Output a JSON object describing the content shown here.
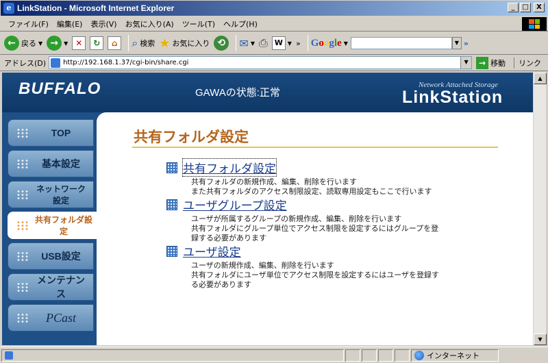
{
  "window": {
    "title": "LinkStation - Microsoft Internet Explorer",
    "controls": {
      "minimize": "_",
      "maximize": "□",
      "close": "X"
    }
  },
  "menu": [
    "ファイル(F)",
    "編集(E)",
    "表示(V)",
    "お気に入り(A)",
    "ツール(T)",
    "ヘルプ(H)"
  ],
  "toolbar": {
    "back_label": "戻る",
    "search_label": "検索",
    "favorites_label": "お気に入り",
    "more": "»",
    "google_search_value": ""
  },
  "address": {
    "label": "アドレス(D)",
    "url": "http://192.168.1.37/cgi-bin/share.cgi",
    "go_label": "移動",
    "links_label": "リンク"
  },
  "banner": {
    "brand": "BUFFALO",
    "status": "GAWAの状態:正常",
    "product_small": "Network Attached Storage",
    "product_big": "LinkStation"
  },
  "nav": [
    {
      "label": "TOP",
      "active": false
    },
    {
      "label": "基本設定",
      "active": false
    },
    {
      "label": "ネットワーク設定",
      "active": false
    },
    {
      "label": "共有フォルダ設定",
      "active": true
    },
    {
      "label": "USB設定",
      "active": false
    },
    {
      "label": "メンテナンス",
      "active": false
    },
    {
      "label": "PCast",
      "active": false
    }
  ],
  "content": {
    "title": "共有フォルダ設定",
    "sections": [
      {
        "link": "共有フォルダ設定",
        "desc": [
          "共有フォルダの新規作成、編集、削除を行います",
          "また共有フォルダのアクセス制限設定、読取専用設定もここで行います"
        ]
      },
      {
        "link": "ユーザグループ設定",
        "desc": [
          "ユーザが所属するグループの新規作成、編集、削除を行います",
          "共有フォルダにグループ単位でアクセス制限を設定するにはグループを登",
          "録する必要があります"
        ]
      },
      {
        "link": "ユーザ設定",
        "desc": [
          "ユーザの新規作成、編集、削除を行います",
          "共有フォルダにユーザ単位でアクセス制限を設定するにはユーザを登録す",
          "る必要があります"
        ]
      }
    ]
  },
  "statusbar": {
    "zone": "インターネット"
  }
}
